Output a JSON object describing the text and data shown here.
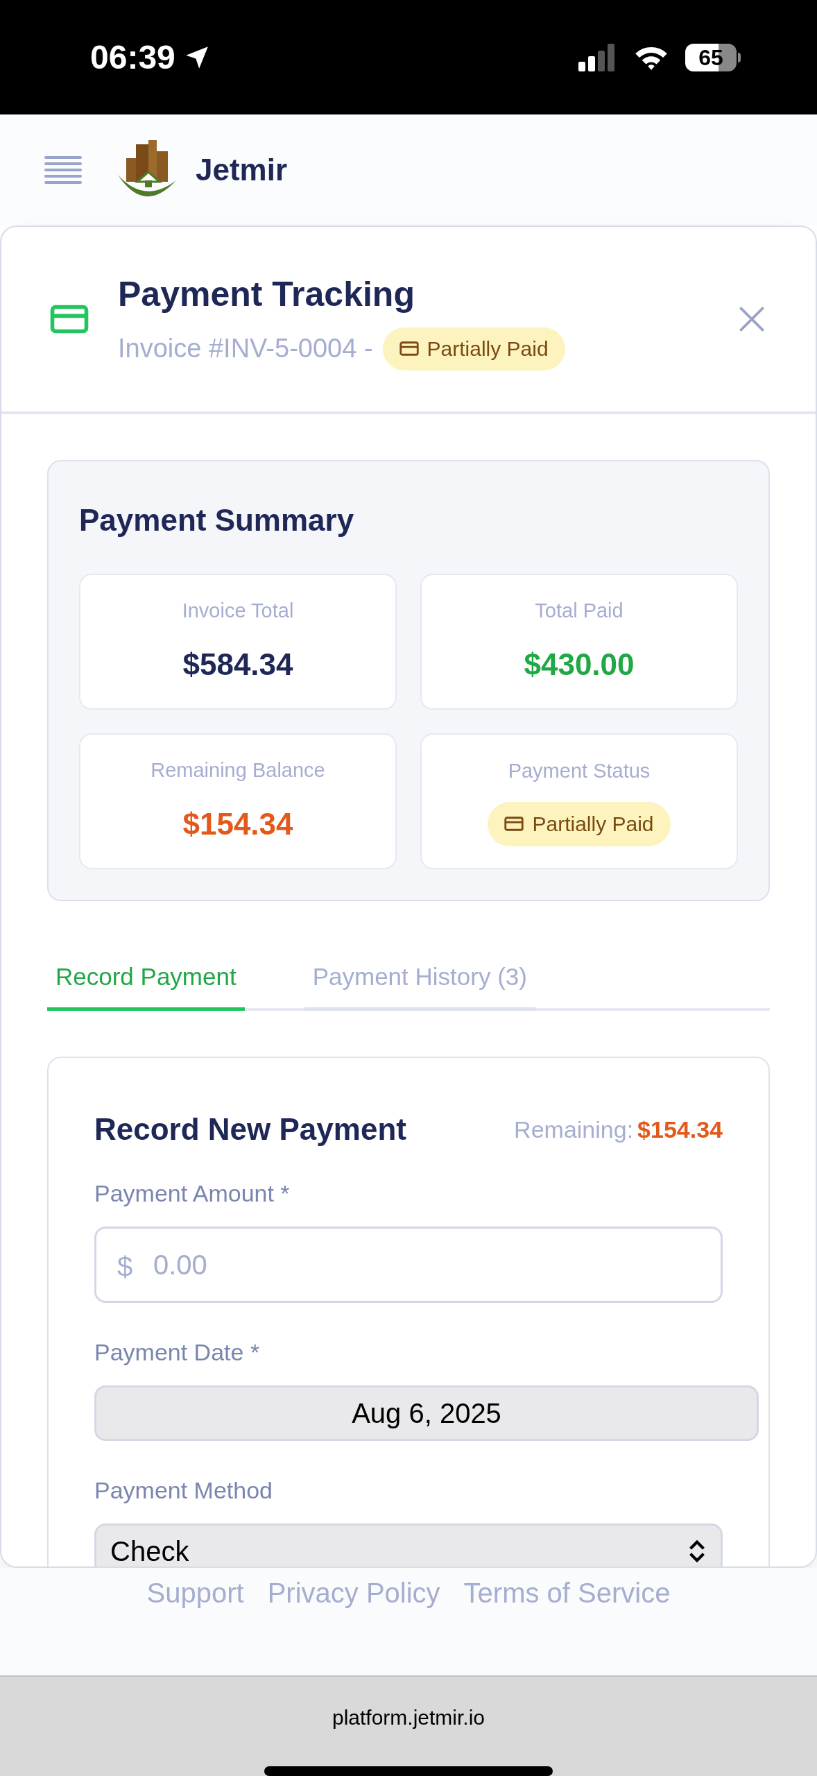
{
  "status_bar": {
    "time": "06:39",
    "battery": "65"
  },
  "header": {
    "brand": "Jetmir"
  },
  "modal": {
    "title": "Payment Tracking",
    "subtitle": "Invoice #INV-5-0004 -",
    "badge": "Partially Paid"
  },
  "summary": {
    "title": "Payment Summary",
    "stats": [
      {
        "kind": "amount",
        "label": "Invoice Total",
        "value": "$584.34",
        "color": "#1e2756"
      },
      {
        "kind": "amount",
        "label": "Total Paid",
        "value": "$430.00",
        "color": "#22a745"
      },
      {
        "kind": "amount",
        "label": "Remaining Balance",
        "value": "$154.34",
        "color": "#e2591b"
      },
      {
        "kind": "badge",
        "label": "Payment Status",
        "value": "Partially Paid"
      }
    ]
  },
  "tabs": [
    {
      "label": "Record Payment",
      "selected": true
    },
    {
      "label": "Payment History (3)",
      "selected": false
    }
  ],
  "form": {
    "title": "Record New Payment",
    "remaining_label": "Remaining:",
    "remaining_value": "$154.34",
    "fields": [
      {
        "kind": "amount",
        "label": "Payment Amount *",
        "prefix": "$",
        "placeholder": "0.00"
      },
      {
        "kind": "date",
        "label": "Payment Date *",
        "value": "Aug 6, 2025"
      },
      {
        "kind": "select",
        "label": "Payment Method",
        "value": "Check"
      }
    ]
  },
  "footer_links": [
    "Support",
    "Privacy Policy",
    "Terms of Service"
  ],
  "browser": {
    "url": "platform.jetmir.io"
  }
}
